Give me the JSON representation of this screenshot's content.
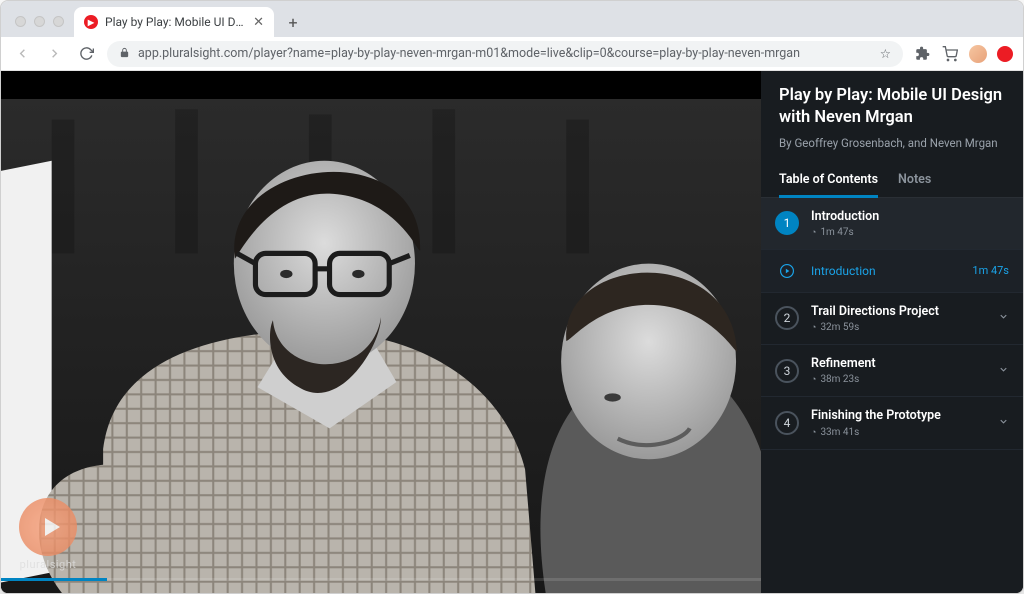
{
  "browser": {
    "tab_title": "Play by Play: Mobile UI Design",
    "url": "app.pluralsight.com/player?name=play-by-play-neven-mrgan-m01&mode=live&clip=0&course=play-by-play-neven-mrgan"
  },
  "course": {
    "title": "Play by Play: Mobile UI Design with Neven Mrgan",
    "byline": "By Geoffrey Grosenbach, and Neven Mrgan"
  },
  "tabs": {
    "toc": "Table of Contents",
    "notes": "Notes"
  },
  "watermark": "pluralsight",
  "modules": [
    {
      "num": "1",
      "title": "Introduction",
      "duration": "1m 47s",
      "expanded": true,
      "clips": [
        {
          "title": "Introduction",
          "duration": "1m 47s",
          "playing": true
        }
      ]
    },
    {
      "num": "2",
      "title": "Trail Directions Project",
      "duration": "32m 59s",
      "expanded": false,
      "clips": []
    },
    {
      "num": "3",
      "title": "Refinement",
      "duration": "38m 23s",
      "expanded": false,
      "clips": []
    },
    {
      "num": "4",
      "title": "Finishing the Prototype",
      "duration": "33m 41s",
      "expanded": false,
      "clips": []
    }
  ]
}
